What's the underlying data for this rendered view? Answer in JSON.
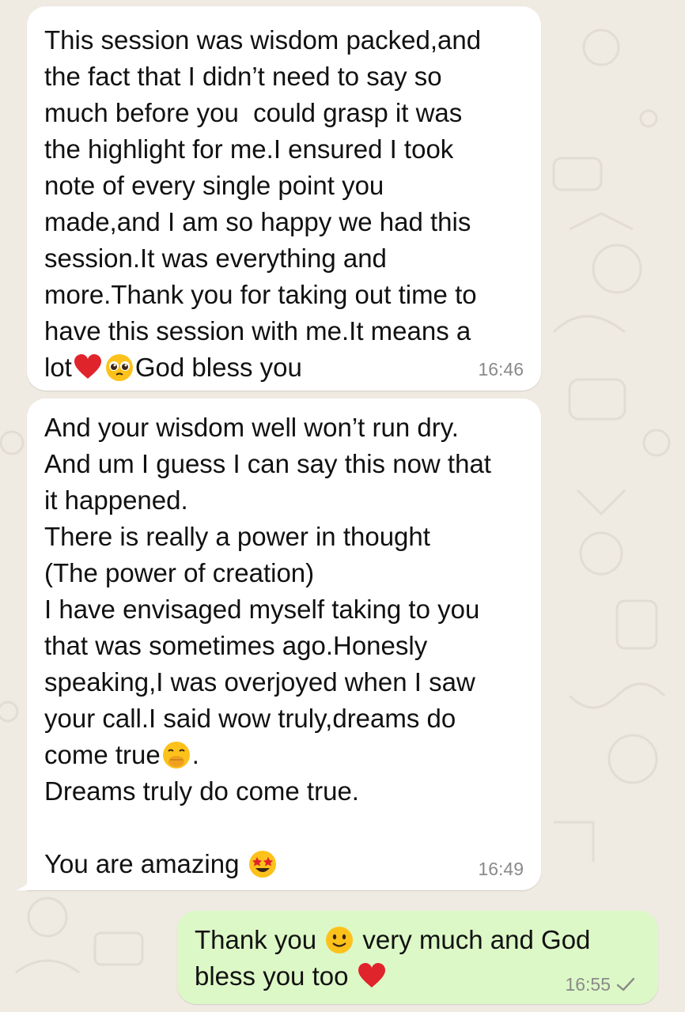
{
  "messages": [
    {
      "direction": "incoming",
      "text_before": "This session was wisdom packed,and\nthe fact that I didn’t need to say so\nmuch before you  could grasp it was\nthe highlight for me.I ensured I took\nnote of every single point you\nmade,and I am so happy we had this\nsession.It was everything and\nmore.Thank you for taking out time to\nhave this session with me.It means a\nlot",
      "emojis": [
        "red-heart",
        "pleading-face"
      ],
      "text_after": "God bless you",
      "time": "16:46"
    },
    {
      "direction": "incoming",
      "text_before": "And your wisdom well won’t run dry.\nAnd um I guess I can say this now that\nit happened.\nThere is really a power in thought\n(The power of creation)\nI have envisaged myself taking to you\nthat was sometimes ago.Honesly\nspeaking,I was overjoyed when I saw\nyour call.I said wow truly,dreams do\ncome true",
      "emoji_mid": "face-with-hand-over-mouth",
      "text_after": ".\nDreams truly do come true.\n\nYou are amazing ",
      "emoji_end": "star-struck",
      "time": "16:49"
    },
    {
      "direction": "outgoing",
      "text_line1_a": "Thank you ",
      "emoji_1": "slightly-smiling-face",
      "text_line1_b": " very much and God",
      "text_line2": "bless you too ",
      "emoji_2": "red-heart",
      "time": "16:55",
      "status": "sent-single-check"
    }
  ],
  "colors": {
    "background": "#efeae2",
    "incoming_bubble": "#ffffff",
    "outgoing_bubble": "#dcf8c6",
    "timestamp": "#8a8a8a",
    "heart": "#e0242b"
  }
}
